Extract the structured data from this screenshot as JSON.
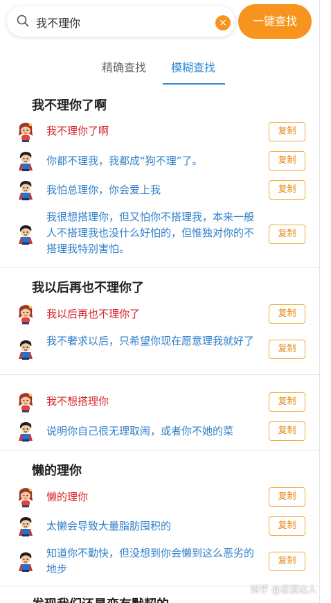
{
  "search": {
    "query": "我不理你",
    "clear_icon": "×",
    "button_label": "一键查找"
  },
  "tabs": [
    {
      "label": "精确查找"
    },
    {
      "label": "模糊查找"
    }
  ],
  "groups": [
    {
      "title": "我不理你了啊",
      "rows": [
        {
          "text": "我不理你了啊"
        },
        {
          "text": "你都不理我，我都成“狗不理”了。"
        },
        {
          "text": "我怕总理你，你会爱上我"
        },
        {
          "text": "我很想搭理你，但又怕你不搭理我，本来一般人不搭理我也没什么好怕的，但惟独对你的不搭理我特别害怕。"
        }
      ]
    },
    {
      "title": "我以后再也不理你了",
      "rows": [
        {
          "text": "我以后再也不理你了"
        },
        {
          "text": "我不奢求以后，只希望你现在愿意理我就好了"
        }
      ]
    },
    {
      "title": "",
      "rows": [
        {
          "text": "我不想搭理你"
        },
        {
          "text": "说明你自己很无理取闹，或者你不她的菜"
        }
      ]
    },
    {
      "title": "懒的理你",
      "rows": [
        {
          "text": "懒的理你"
        },
        {
          "text": "太懒会导致大量脂肪囤积的"
        },
        {
          "text": "知道你不勤快，但没想到你会懒到这么恶劣的地步"
        }
      ]
    },
    {
      "title": "发现我们还是变有默契的"
    }
  ],
  "copy_label": "复制",
  "watermark": "知乎 @恋爱达人",
  "colors": {
    "accent": "#f7941d",
    "tab_active": "#2f89d4",
    "question": "#d9232d",
    "answer": "#2f7fc9"
  },
  "icons": {
    "search": "search-icon",
    "girl": "girl-avatar-icon",
    "boy": "boy-avatar-icon"
  }
}
